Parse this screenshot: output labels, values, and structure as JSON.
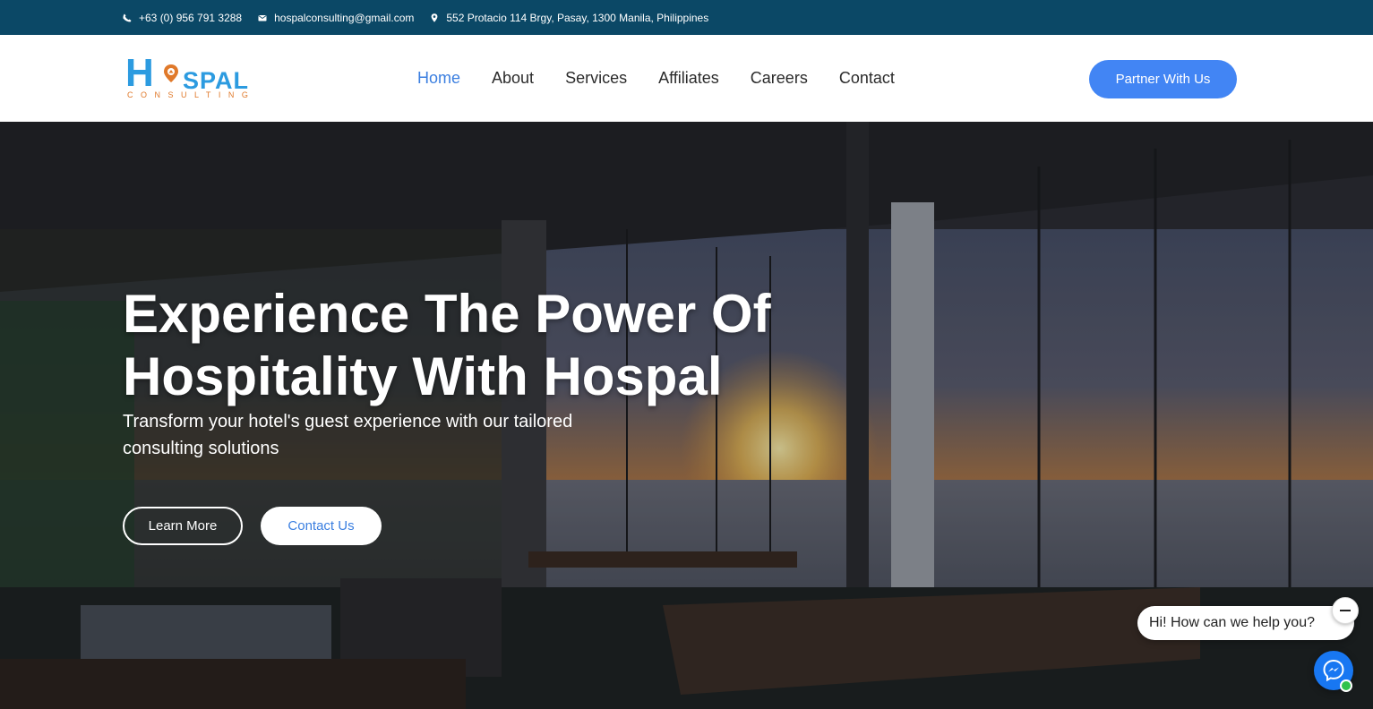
{
  "topbar": {
    "phone": "+63 (0) 956 791 3288",
    "email": "hospalconsulting@gmail.com",
    "address": "552 Protacio 114 Brgy, Pasay, 1300 Manila, Philippines"
  },
  "logo": {
    "letter": "H",
    "rest": "SPAL",
    "subtitle": "CONSULTING"
  },
  "nav": {
    "items": [
      {
        "label": "Home",
        "active": true
      },
      {
        "label": "About"
      },
      {
        "label": "Services"
      },
      {
        "label": "Affiliates"
      },
      {
        "label": "Careers"
      },
      {
        "label": "Contact"
      }
    ]
  },
  "header": {
    "cta_label": "Partner With Us"
  },
  "hero": {
    "title": "Experience The Power Of Hospitality With Hospal",
    "subtitle": "Transform your hotel's guest experience with our tailored consulting solutions",
    "learn_more": "Learn More",
    "contact_us": "Contact Us"
  },
  "chat": {
    "greeting": "Hi! How can we help you?"
  },
  "colors": {
    "topbar_bg": "#0b4866",
    "brand_blue": "#2c9be0",
    "accent_orange": "#e0792a",
    "button_blue": "#4285f4",
    "messenger_blue": "#1877f2"
  }
}
